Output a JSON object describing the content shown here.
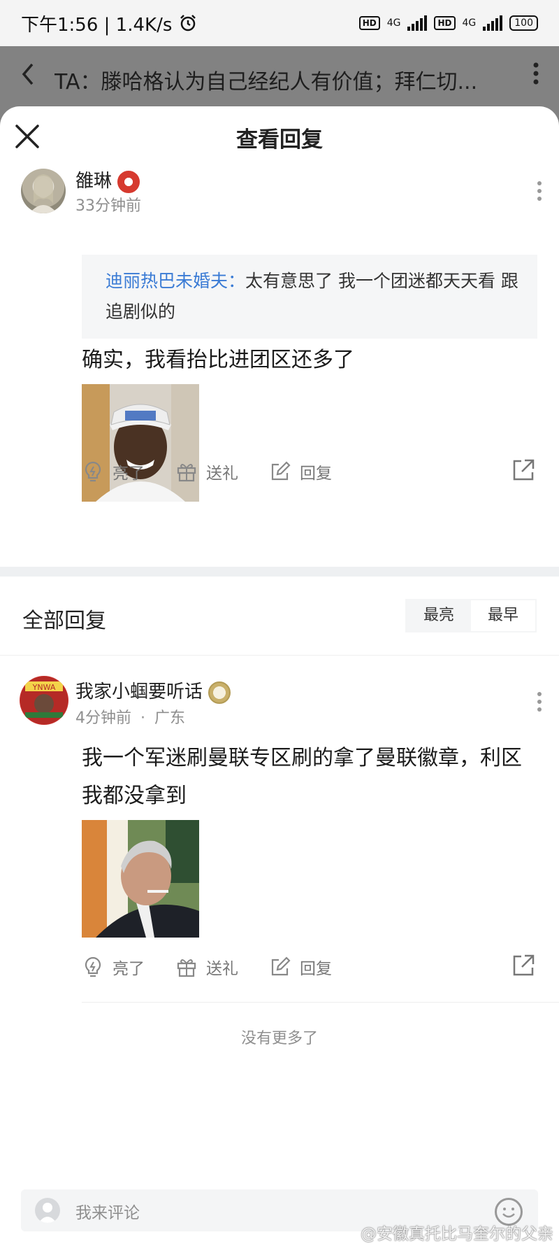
{
  "status": {
    "time_speed": "下午1:56 | 1.4K/s",
    "net1": "4G",
    "net2": "4G",
    "hd": "HD",
    "battery": "100"
  },
  "header": {
    "title": "TA：滕哈格认为自己经纪人有价值；拜仁切..."
  },
  "sheet": {
    "title": "查看回复"
  },
  "main_comment": {
    "user": "雒琳",
    "time": "33分钟前",
    "quote_name": "迪丽热巴未婚夫：",
    "quote_text": "太有意思了 我一个团迷都天天看 跟追剧似的",
    "text": "确实，我看抬比进团区还多了",
    "actions": {
      "like": "亮了",
      "gift": "送礼",
      "reply": "回复"
    }
  },
  "all_replies": {
    "title": "全部回复",
    "sort": [
      "最亮",
      "最早"
    ],
    "active_sort": "最早"
  },
  "reply": {
    "user": "我家小蝈要听话",
    "time": "4分钟前",
    "location": "广东",
    "sep": "·",
    "text": "我一个军迷刷曼联专区刷的拿了曼联徽章，利区我都没拿到",
    "actions": {
      "like": "亮了",
      "gift": "送礼",
      "reply": "回复"
    }
  },
  "no_more": "没有更多了",
  "bottom": {
    "placeholder": "我来评论",
    "watermark": "@安徽真托比马奎尔的父亲"
  },
  "colors": {
    "link_blue": "#3a7bd5",
    "dim_header": "#828282",
    "muted": "#8f8f8f"
  }
}
